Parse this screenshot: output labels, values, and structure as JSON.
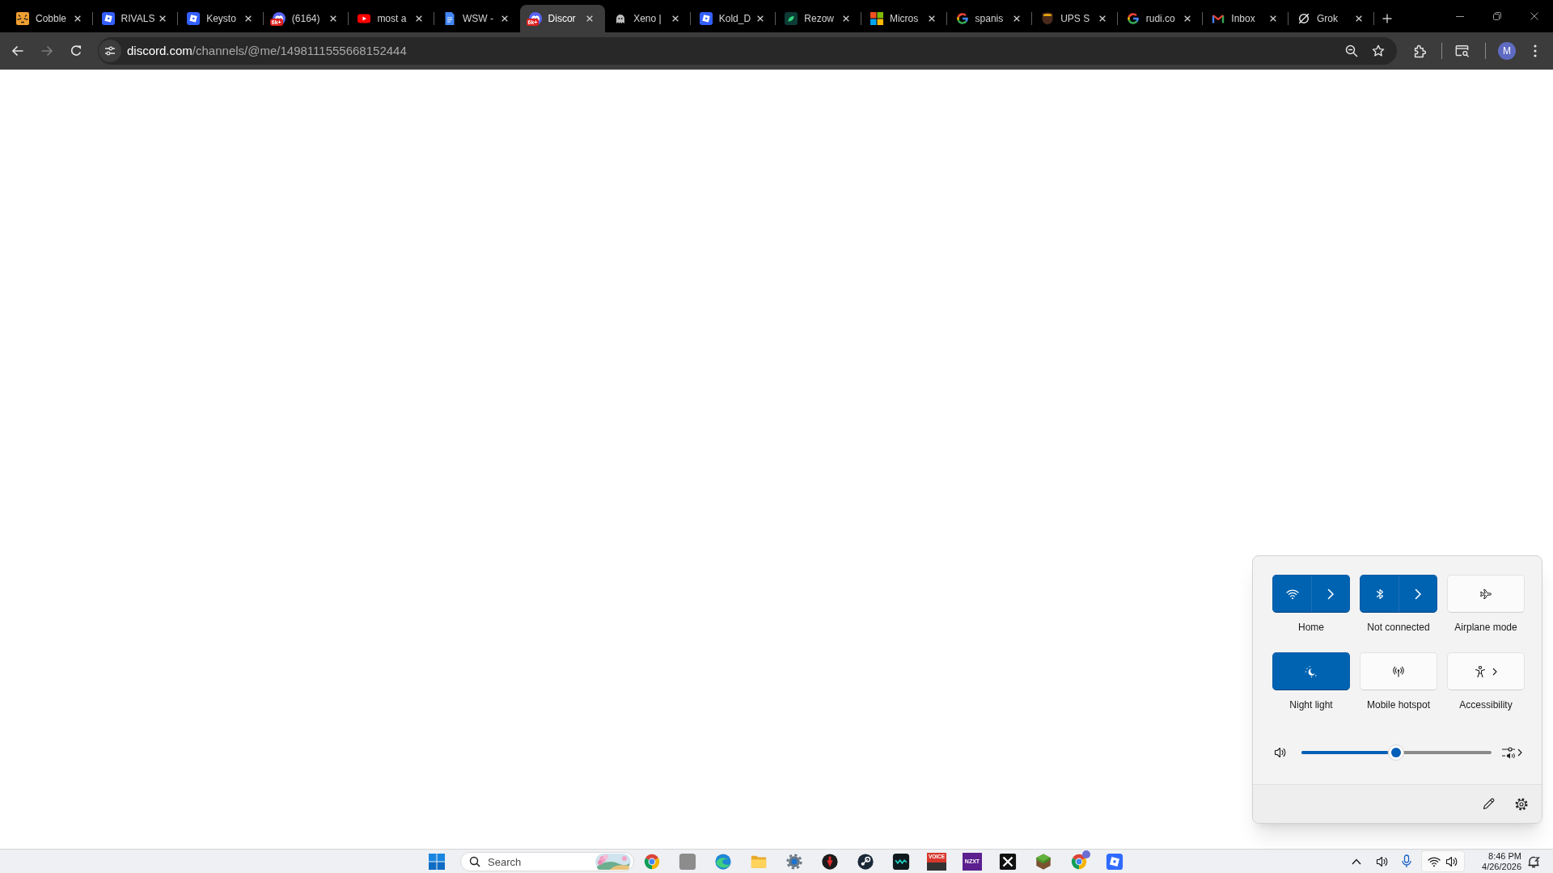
{
  "browser": {
    "tabs": [
      {
        "title": "Cobble",
        "selected": false
      },
      {
        "title": "RIVALS",
        "selected": false
      },
      {
        "title": "Keysto",
        "selected": false
      },
      {
        "title": "(6164)",
        "selected": false,
        "badge": "6k+"
      },
      {
        "title": "most a",
        "selected": false
      },
      {
        "title": "WSW -",
        "selected": false
      },
      {
        "title": "Discor",
        "selected": true,
        "badge": "6k+"
      },
      {
        "title": "Xeno |",
        "selected": false
      },
      {
        "title": "Kold_D",
        "selected": false
      },
      {
        "title": "Rezow",
        "selected": false
      },
      {
        "title": "Micros",
        "selected": false
      },
      {
        "title": "spanis",
        "selected": false
      },
      {
        "title": "UPS S",
        "selected": false
      },
      {
        "title": "rudi.co",
        "selected": false
      },
      {
        "title": "Inbox",
        "selected": false
      },
      {
        "title": "Grok",
        "selected": false
      }
    ],
    "back": {
      "disabled": false
    },
    "forward": {
      "disabled": true
    },
    "address_bar": {
      "host": "discord.com",
      "path": "/channels/@me/1498111555668152444"
    },
    "profile": {
      "initial": "M"
    }
  },
  "quick_settings": {
    "tiles": [
      {
        "label": "Home",
        "on": true,
        "kind": "split"
      },
      {
        "label": "Not connected",
        "on": true,
        "kind": "split"
      },
      {
        "label": "Airplane mode",
        "on": false,
        "kind": "toggle"
      },
      {
        "label": "Night light",
        "on": true,
        "kind": "toggle"
      },
      {
        "label": "Mobile hotspot",
        "on": false,
        "kind": "toggle"
      },
      {
        "label": "Accessibility",
        "on": false,
        "kind": "menu"
      }
    ],
    "volume": {
      "level": 0.5
    }
  },
  "taskbar": {
    "search": {
      "placeholder": "Search"
    },
    "logo_texts": [
      "VOICE",
      "NZXT"
    ],
    "clock": {
      "time": "8:46 PM",
      "date": "4/26/2026"
    }
  }
}
